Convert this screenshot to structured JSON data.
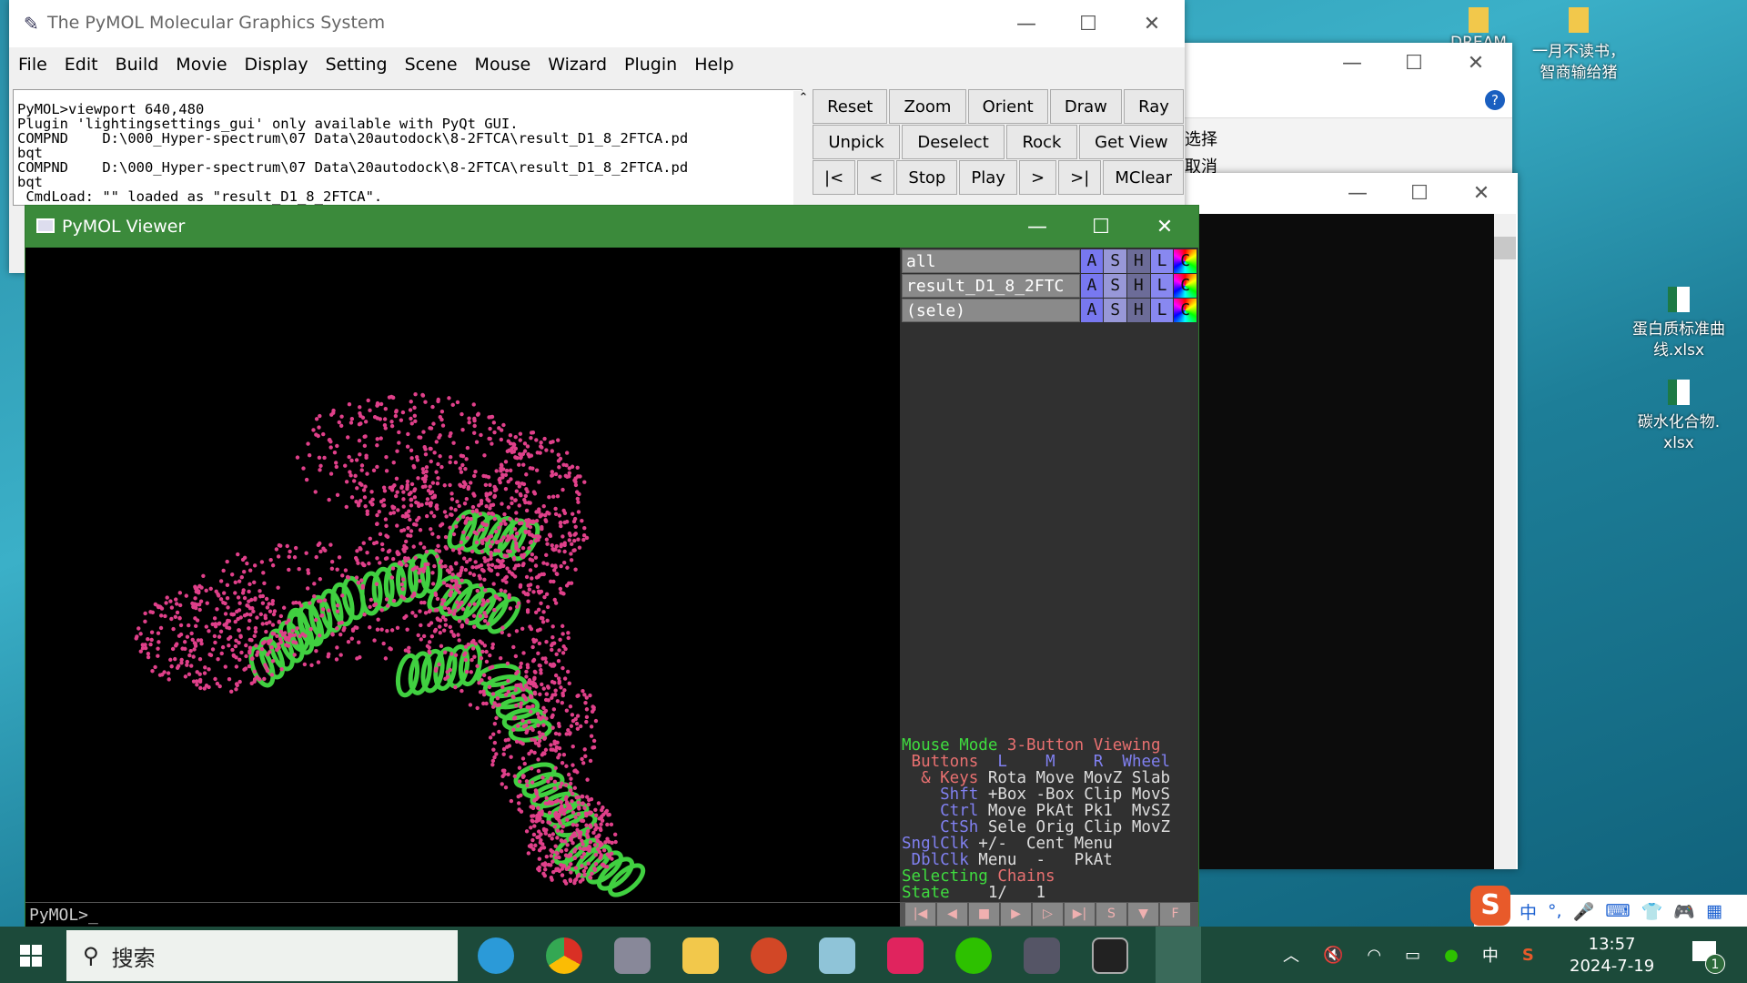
{
  "pymol_main": {
    "title": "The PyMOL Molecular Graphics System",
    "menu": [
      "File",
      "Edit",
      "Build",
      "Movie",
      "Display",
      "Setting",
      "Scene",
      "Mouse",
      "Wizard",
      "Plugin",
      "Help"
    ],
    "console_lines": [
      "PyMOL>viewport 640,480",
      "Plugin 'lightingsettings_gui' only available with PyQt GUI.",
      "COMPND    D:\\000_Hyper-spectrum\\07 Data\\20autodock\\8-2FTCA\\result_D1_8_2FTCA.pd",
      "bqt",
      "COMPND    D:\\000_Hyper-spectrum\\07 Data\\20autodock\\8-2FTCA\\result_D1_8_2FTCA.pd",
      "bqt",
      " CmdLoad: \"\" loaded as \"result_D1_8_2FTCA\"."
    ],
    "buttons_row1": [
      "Reset",
      "Zoom",
      "Orient",
      "Draw",
      "Ray"
    ],
    "buttons_row2": [
      "Unpick",
      "Deselect",
      "Rock",
      "Get View"
    ],
    "buttons_row3": [
      "|<",
      "<",
      "Stop",
      "Play",
      ">",
      ">|",
      "MClear"
    ]
  },
  "viewer": {
    "title": "PyMOL Viewer",
    "objects": [
      {
        "name": "all"
      },
      {
        "name": "result_D1_8_2FTC"
      },
      {
        "name": "(sele)"
      }
    ],
    "object_buttons": [
      "A",
      "S",
      "H",
      "L",
      "C"
    ],
    "mouse_mode": {
      "l1a": "Mouse Mode ",
      "l1b": "3-Button Viewing",
      "buttons": " Buttons",
      "bl": "L",
      "bm": "M",
      "br": "R",
      "bw": "Wheel",
      "keys": "  & Keys",
      "keys_vals": " Rota Move MovZ Slab",
      "shft": "    Shft",
      "shft_vals": " +Box -Box Clip MovS",
      "ctrl": "    Ctrl",
      "ctrl_vals": " Move PkAt Pk1  MvSZ",
      "ctsh": "    CtSh",
      "ctsh_vals": " Sele Orig Clip MovZ",
      "sngl": "SnglClk",
      "sngl_vals": " +/-  Cent Menu",
      "dbl": " DblClk",
      "dbl_vals": " Menu  -   PkAt",
      "selecting": "Selecting ",
      "selecting_val": "Chains",
      "state": "State",
      "state_val": "    1/   1"
    },
    "command_prompt": "PyMOL>_",
    "player_buttons": [
      "|◀",
      "◀",
      "■",
      "▶",
      "▷",
      "▶|",
      "S",
      "▼",
      "F"
    ],
    "colors": {
      "atoms": "#e0408a",
      "ribbon": "#40d040",
      "title_bar": "#3b8a3b"
    }
  },
  "background_window": {
    "text1": "选择",
    "text2": "取消"
  },
  "desktop_icons": [
    {
      "label": "DREAM"
    },
    {
      "label": "一月不读书，\n智商输给猪"
    },
    {
      "label": "蛋白质标准曲\n线.xlsx"
    },
    {
      "label": "碳水化合物.\nxlsx"
    }
  ],
  "taskbar": {
    "search_placeholder": "搜索",
    "time": "13:57",
    "date": "2024-7-19",
    "ime": "中",
    "notification_count": "1"
  },
  "ime_bar": [
    "中",
    "°,",
    "🎤",
    "⌨",
    "👕",
    "🎮",
    "▦"
  ]
}
